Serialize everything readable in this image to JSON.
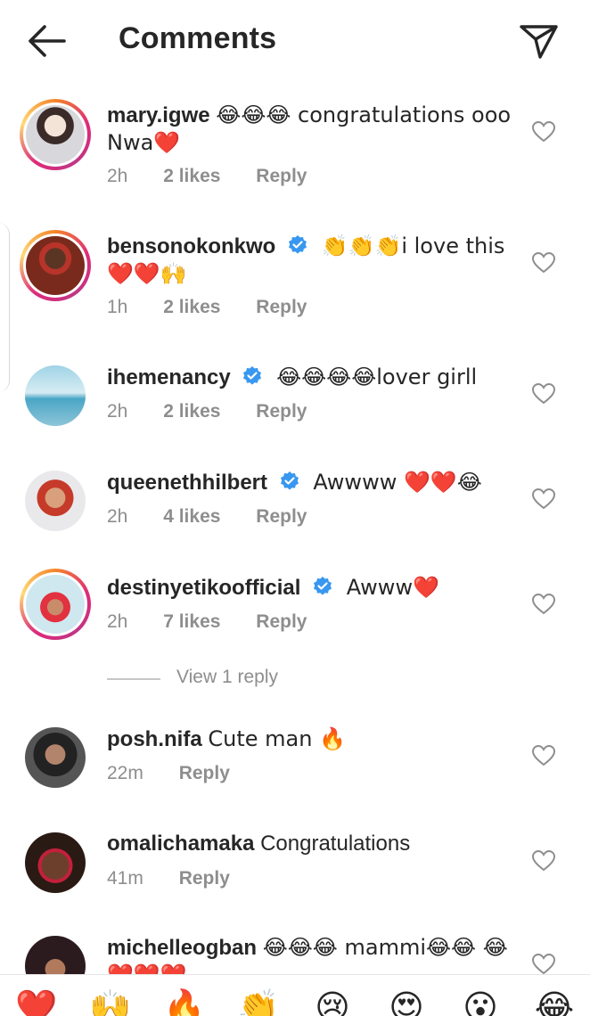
{
  "header": {
    "title": "Comments",
    "back_icon": "arrow-left-icon",
    "send_icon": "paper-plane-icon"
  },
  "comments": [
    {
      "username": "mary.igwe",
      "verified": false,
      "text": "😂😂😂 congratulations ooo Nwa❤️",
      "time": "2h",
      "likes": "2 likes",
      "reply": "Reply",
      "story_ring": true
    },
    {
      "username": "bensonokonkwo",
      "verified": true,
      "text": "👏👏👏i love this ❤️❤️🙌",
      "time": "1h",
      "likes": "2 likes",
      "reply": "Reply",
      "story_ring": true
    },
    {
      "username": "ihemenancy",
      "verified": true,
      "text": "😂😂😂😂lover girll",
      "time": "2h",
      "likes": "2 likes",
      "reply": "Reply",
      "story_ring": false
    },
    {
      "username": "queenethhilbert",
      "verified": true,
      "text": "Awwww ❤️❤️😂",
      "time": "2h",
      "likes": "4 likes",
      "reply": "Reply",
      "story_ring": false
    },
    {
      "username": "destinyetikoofficial",
      "verified": true,
      "text": "Awww❤️",
      "time": "2h",
      "likes": "7 likes",
      "reply": "Reply",
      "story_ring": true
    },
    {
      "username": "posh.nifa",
      "verified": false,
      "text": "Cute man 🔥",
      "time": "22m",
      "likes": "",
      "reply": "Reply",
      "story_ring": false
    },
    {
      "username": "omalichamaka",
      "verified": false,
      "text": "Congratulations",
      "time": "41m",
      "likes": "",
      "reply": "Reply",
      "story_ring": false
    },
    {
      "username": "michelleogban",
      "verified": false,
      "text": "😂😂😂 mammi😂😂 😂❤️❤️❤️",
      "time": "",
      "likes": "",
      "reply": "",
      "story_ring": false
    }
  ],
  "view_replies": "View 1 reply",
  "emoji_bar": [
    "❤️",
    "🙌",
    "🔥",
    "👏",
    "😢",
    "😍",
    "😮",
    "😂"
  ],
  "colors": {
    "text": "#262626",
    "secondary": "#8e8e8e",
    "verified": "#3897f0",
    "heart": "#e0242b"
  }
}
